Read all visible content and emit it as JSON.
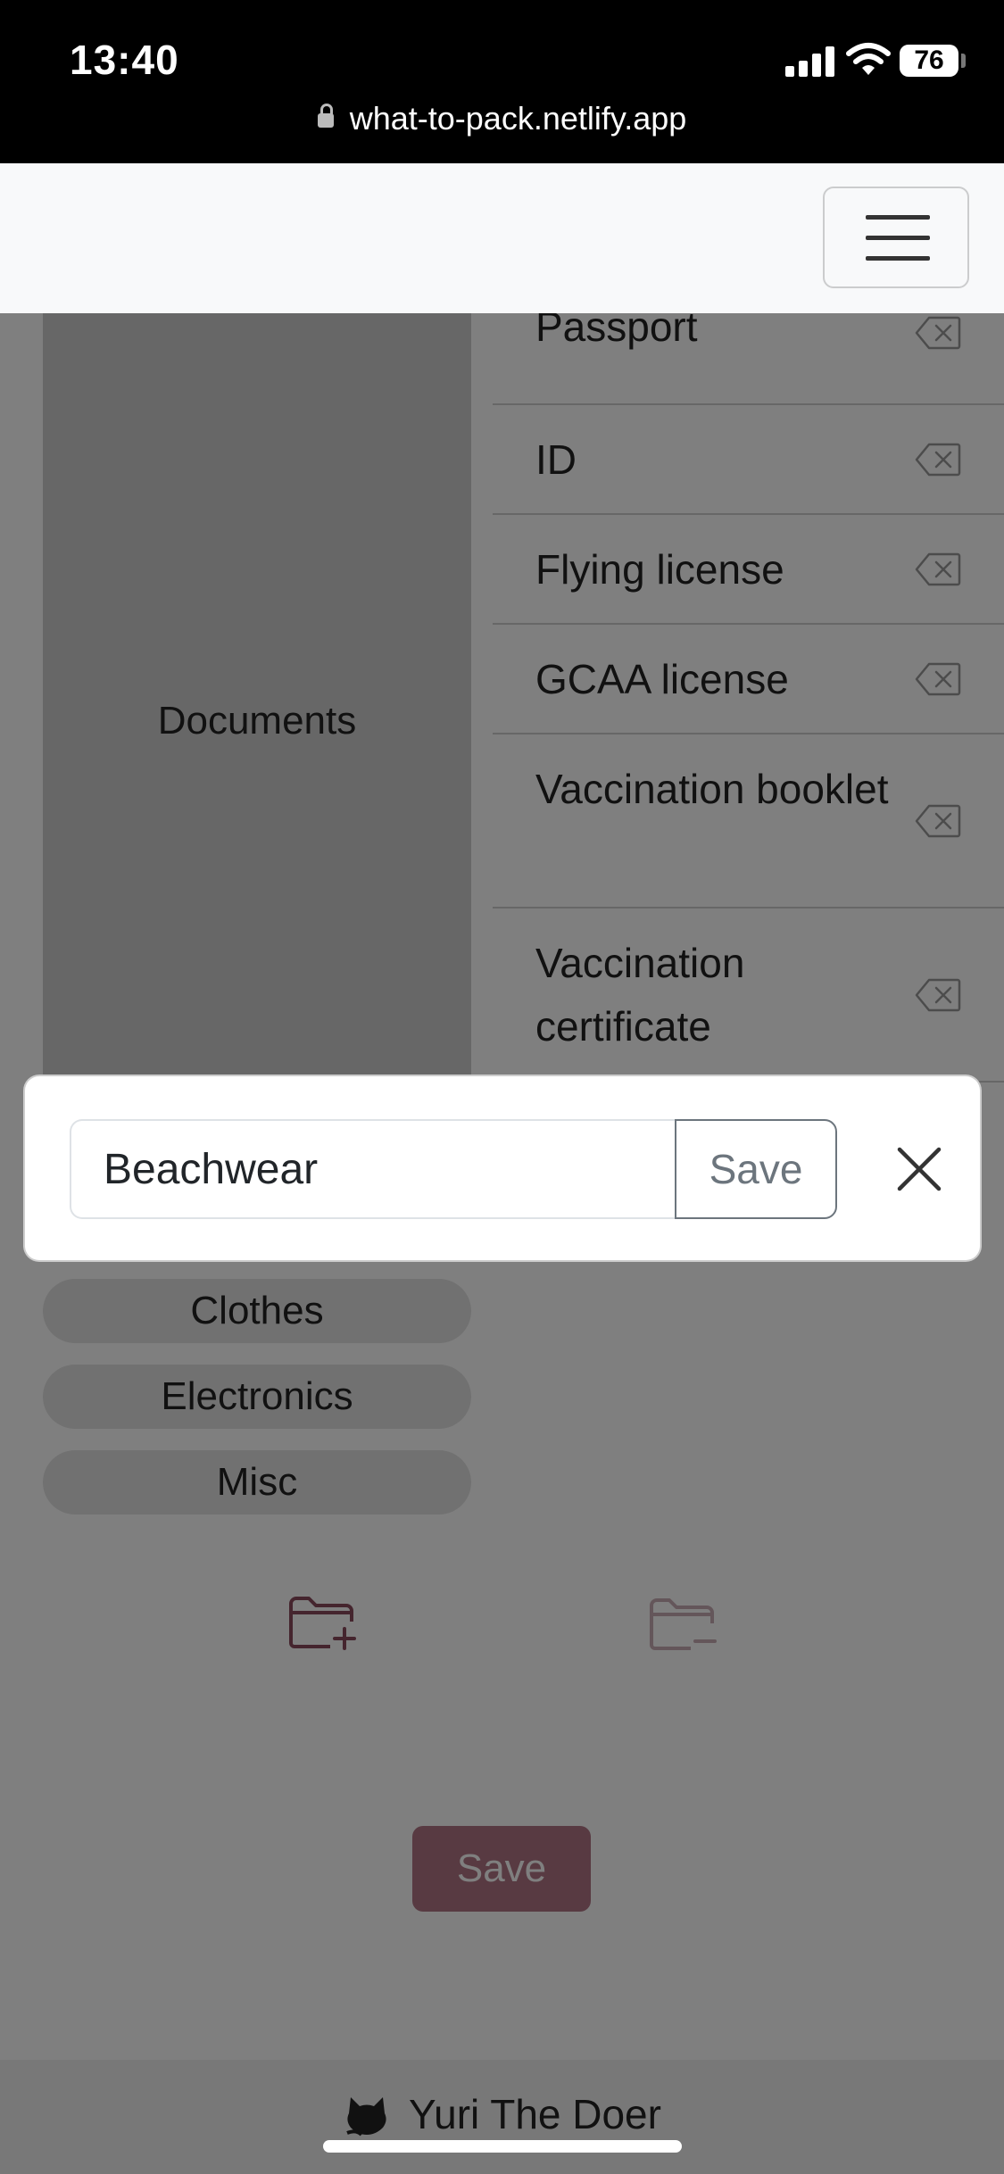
{
  "status_bar": {
    "time": "13:40",
    "battery": "76",
    "url": "what-to-pack.netlify.app"
  },
  "category": {
    "name": "Documents"
  },
  "items": [
    {
      "label": "Passport"
    },
    {
      "label": "ID"
    },
    {
      "label": "Flying license"
    },
    {
      "label": "GCAA license"
    },
    {
      "label": "Vaccination booklet"
    },
    {
      "label": "Vaccination certificate"
    }
  ],
  "other_categories": [
    "Clothes",
    "Electronics",
    "Misc"
  ],
  "main": {
    "save_label": "Save"
  },
  "footer": {
    "author": "Yuri The Doer"
  },
  "modal": {
    "input_value": "Beachwear",
    "save_label": "Save"
  },
  "colors": {
    "accent": "#b07585",
    "overlay": "rgba(0,0,0,0.5)"
  }
}
